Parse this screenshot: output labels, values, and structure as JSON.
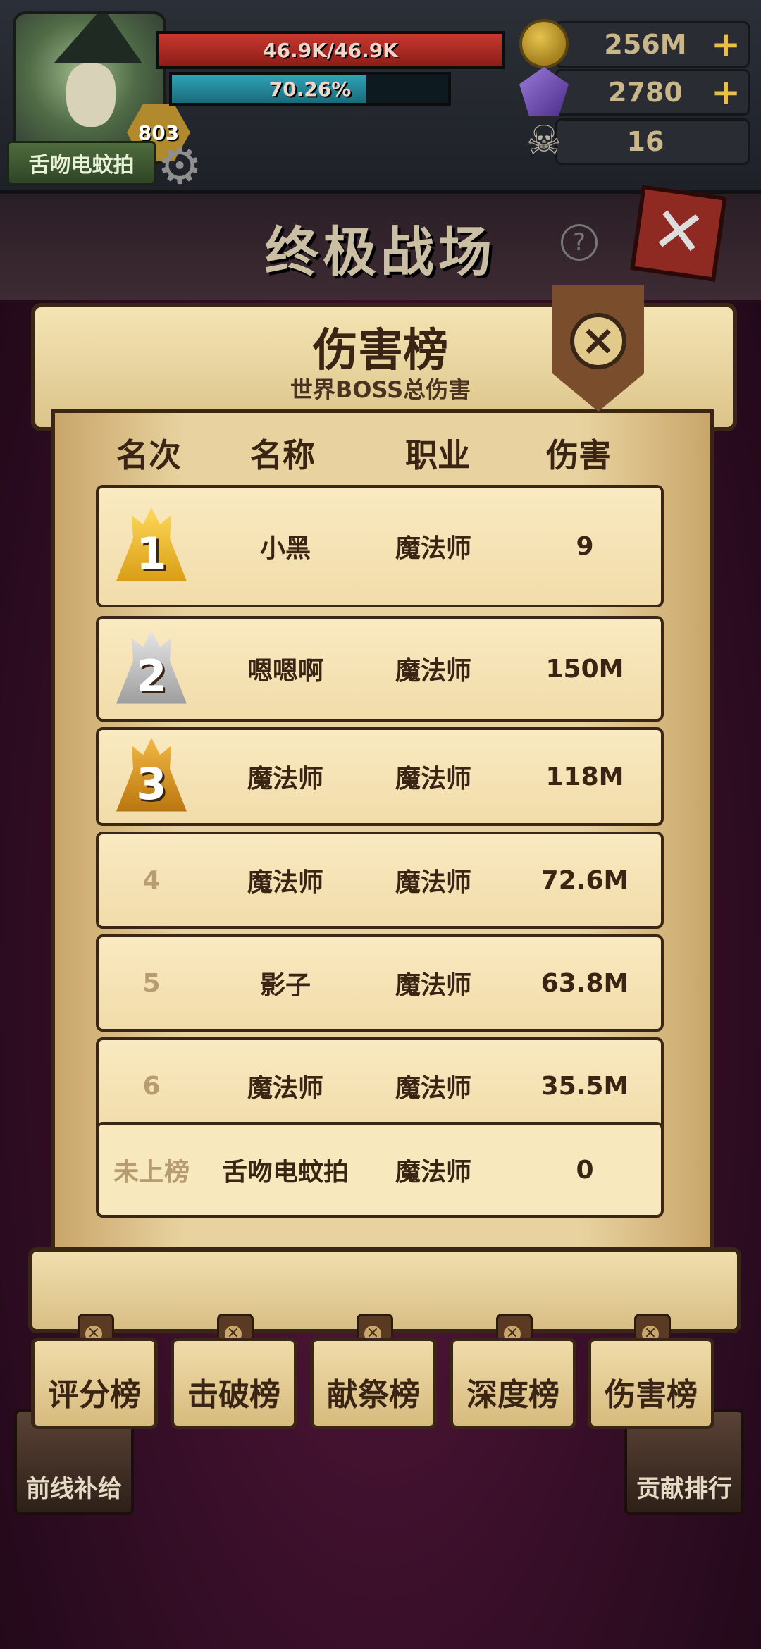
{
  "status": {
    "player_name": "舌吻电蚊拍",
    "level": "803",
    "hp_text": "46.9K/46.9K",
    "xp_text": "70.26%",
    "xp_fraction": 0.7026,
    "gold": "256M",
    "gems": "2780",
    "skull_count": "16",
    "plus": "+"
  },
  "header": {
    "title": "终极战场",
    "help": "?",
    "close": "✕"
  },
  "panel": {
    "title": "伤害榜",
    "subtitle": "世界BOSS总伤害",
    "columns": [
      "名次",
      "名称",
      "职业",
      "伤害"
    ],
    "rows": [
      {
        "rank": "1",
        "name": "小黑",
        "job": "魔法师",
        "damage": "9"
      },
      {
        "rank": "2",
        "name": "嗯嗯啊",
        "job": "魔法师",
        "damage": "150M"
      },
      {
        "rank": "3",
        "name": "魔法师",
        "job": "魔法师",
        "damage": "118M"
      },
      {
        "rank": "4",
        "name": "魔法师",
        "job": "魔法师",
        "damage": "72.6M"
      },
      {
        "rank": "5",
        "name": "影子",
        "job": "魔法师",
        "damage": "63.8M"
      },
      {
        "rank": "6",
        "name": "魔法师",
        "job": "魔法师",
        "damage": "35.5M"
      }
    ],
    "me": {
      "rank": "未上榜",
      "name": "舌吻电蚊拍",
      "job": "魔法师",
      "damage": "0"
    }
  },
  "tabs": [
    "评分榜",
    "击破榜",
    "献祭榜",
    "深度榜",
    "伤害榜"
  ],
  "side": {
    "left": "前线补给",
    "right": "贡献排行"
  }
}
